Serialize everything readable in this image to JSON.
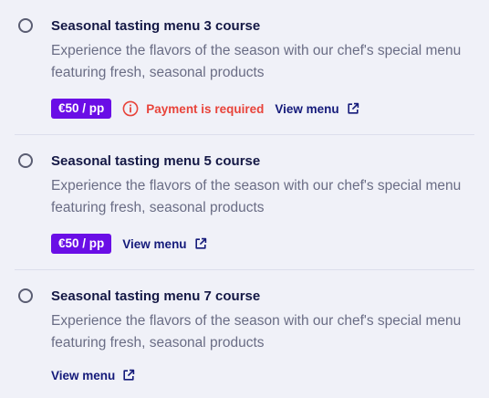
{
  "options": [
    {
      "title": "Seasonal tasting menu 3 course",
      "description": "Experience the flavors of the season with our chef's special menu featuring fresh, seasonal products",
      "price": "€50 / pp",
      "warning": "Payment is required",
      "view_menu": "View menu",
      "selected": false
    },
    {
      "title": "Seasonal tasting menu 5 course",
      "description": "Experience the flavors of the season with our chef's special menu featuring fresh, seasonal products",
      "price": "€50 / pp",
      "view_menu": "View menu",
      "selected": false
    },
    {
      "title": "Seasonal tasting menu 7 course",
      "description": "Experience the flavors of the season with our chef's special menu featuring fresh, seasonal products",
      "view_menu": "View menu",
      "selected": false
    }
  ],
  "icons": {
    "radio": "radio-button-icon",
    "warning": "info-circle-icon",
    "external": "external-link-icon"
  },
  "colors": {
    "background": "#f0f1f8",
    "title": "#141845",
    "description": "#6a6d85",
    "price_badge": "#6a0ee6",
    "warning": "#e8433a",
    "link": "#141a7a"
  }
}
